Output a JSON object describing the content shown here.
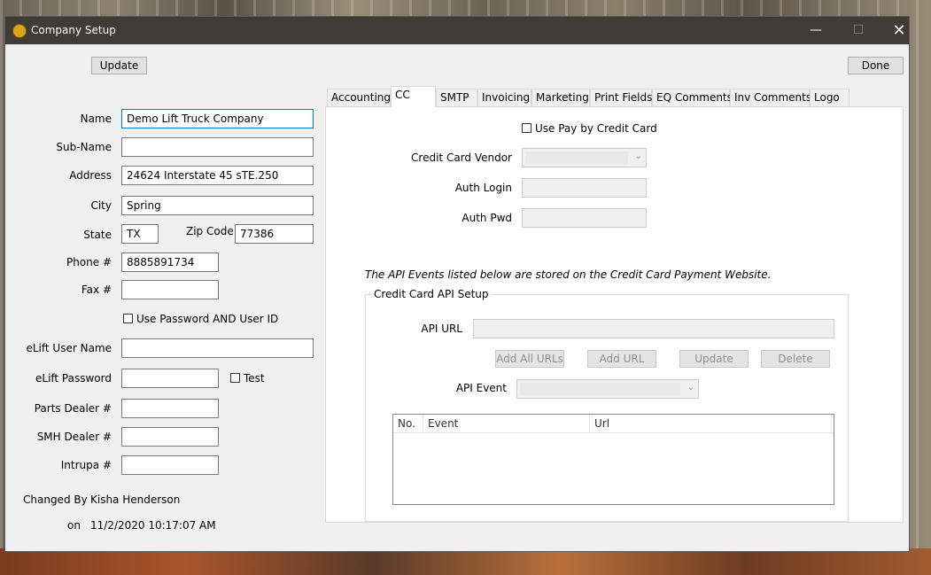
{
  "window": {
    "title": "Company Setup"
  },
  "toolbar": {
    "update_label": "Update",
    "done_label": "Done"
  },
  "form": {
    "name_label": "Name",
    "name_value": "Demo Lift Truck Company",
    "subname_label": "Sub-Name",
    "subname_value": "",
    "address_label": "Address",
    "address_value": "24624 Interstate 45 sTE.250",
    "city_label": "City",
    "city_value": "Spring",
    "state_label": "State",
    "state_value": "TX",
    "zip_label": "Zip Code",
    "zip_value": "77386",
    "phone_label": "Phone #",
    "phone_value": "8885891734",
    "fax_label": "Fax #",
    "fax_value": "",
    "use_password_label": "Use Password AND User ID",
    "elift_user_label": "eLift User Name",
    "elift_user_value": "",
    "elift_pwd_label": "eLift Password",
    "elift_pwd_value": "",
    "test_label": "Test",
    "parts_dealer_label": "Parts Dealer #",
    "parts_dealer_value": "",
    "smh_dealer_label": "SMH Dealer #",
    "smh_dealer_value": "",
    "intrupa_label": "Intrupa #",
    "intrupa_value": "",
    "changed_by_label": "Changed By",
    "changed_by_value": "Kisha Henderson",
    "on_label": "on",
    "on_value": "11/2/2020 10:17:07 AM"
  },
  "tabs": [
    {
      "label": "Accounting"
    },
    {
      "label": "CC",
      "active": true
    },
    {
      "label": "SMTP"
    },
    {
      "label": "Invoicing"
    },
    {
      "label": "Marketing"
    },
    {
      "label": "Print Fields"
    },
    {
      "label": "EQ Comments"
    },
    {
      "label": "Inv Comments"
    },
    {
      "label": "Logo"
    }
  ],
  "cc": {
    "use_pay_label": "Use Pay by Credit Card",
    "vendor_label": "Credit Card Vendor",
    "auth_login_label": "Auth Login",
    "auth_pwd_label": "Auth Pwd",
    "api_note": "The API Events listed below are stored on the Credit Card Payment Website.",
    "group_title": "Credit Card API Setup",
    "api_url_label": "API URL",
    "add_all_urls_label": "Add All URLs",
    "add_url_label": "Add URL",
    "update_label": "Update",
    "delete_label": "Delete",
    "api_event_label": "API Event",
    "columns": [
      "No.",
      "Event",
      "Url"
    ]
  }
}
